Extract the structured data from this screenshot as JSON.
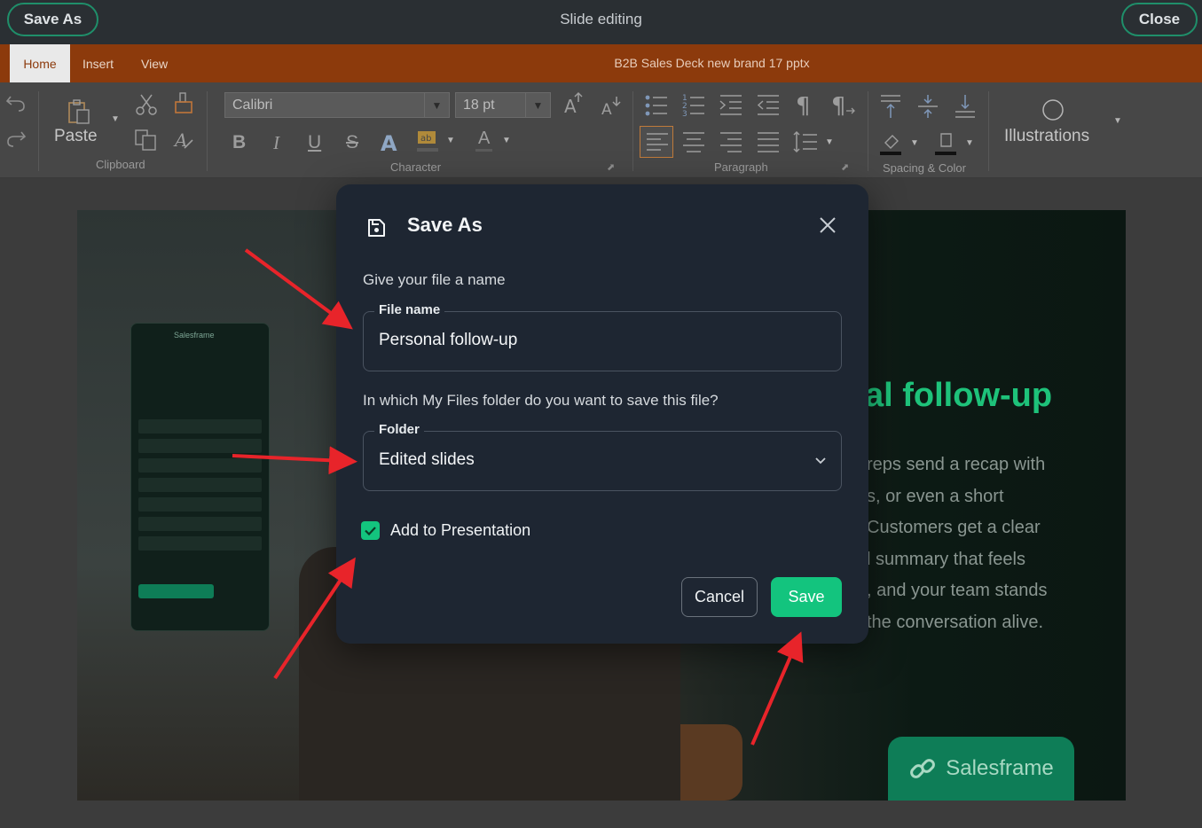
{
  "topbar": {
    "save_as_label": "Save As",
    "title": "Slide editing",
    "close_label": "Close"
  },
  "ribbon": {
    "tabs": [
      {
        "label": "Home",
        "active": true
      },
      {
        "label": "Insert",
        "active": false
      },
      {
        "label": "View",
        "active": false
      }
    ],
    "document_name": "B2B Sales Deck new brand 17 pptx",
    "clipboard": {
      "paste_label": "Paste",
      "group_label": "Clipboard"
    },
    "character": {
      "font_name": "Calibri",
      "font_size": "18 pt",
      "bold": "B",
      "italic": "I",
      "underline": "U",
      "strike": "S",
      "font_color_glyph": "A",
      "group_label": "Character"
    },
    "paragraph": {
      "group_label": "Paragraph"
    },
    "spacing": {
      "group_label": "Spacing & Color"
    },
    "illustrations_label": "Illustrations"
  },
  "slide": {
    "heading_fragment": "al follow-up",
    "body_lines": "reps send a recap with\ns, or even a short\nCustomers get a clear\nl summary that feels\n, and your team stands\nthe conversation alive.",
    "brand_name": "Salesframe",
    "phone_app_name": "Salesframe"
  },
  "dialog": {
    "title": "Save As",
    "subtitle": "Give your file a name",
    "file_name_label": "File name",
    "file_name_value": "Personal follow-up",
    "folder_question": "In which My Files folder do you want to save this file?",
    "folder_label": "Folder",
    "folder_value": "Edited slides",
    "add_to_presentation_label": "Add to Presentation",
    "add_to_presentation_checked": true,
    "cancel_label": "Cancel",
    "save_label": "Save"
  },
  "colors": {
    "accent_green": "#13c47e",
    "ribbon_tab_bar": "#8c3a0c",
    "dialog_bg": "#1e2632",
    "annotation_arrow": "#e8242a"
  }
}
